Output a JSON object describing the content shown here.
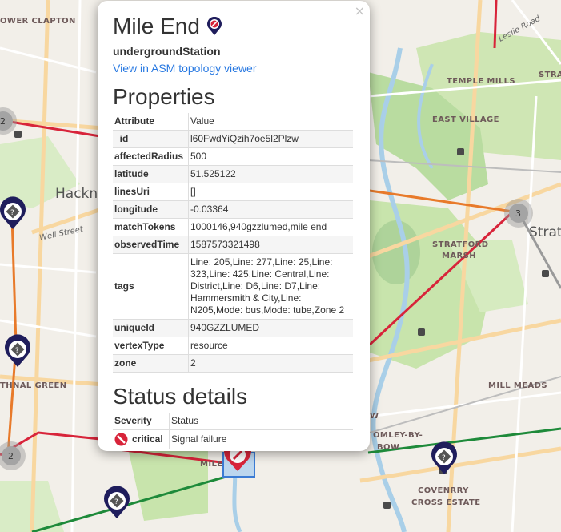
{
  "map": {
    "labels": {
      "lower_clapton": "OWER CLAPTON",
      "temple_mills": "TEMPLE MILLS",
      "east_village": "EAST VILLAGE",
      "strat_top": "STRAT",
      "hackney": "Hackn",
      "well_street": "Well Street",
      "leslie_road": "Leslie Road",
      "stratford": "Strat",
      "stratford_marsh_1": "STRATFORD",
      "stratford_marsh_2": "MARSH",
      "thnal_green": "THNAL GREEN",
      "mill_meads": "MILL MEADS",
      "bromley_1": "OMLEY-BY-",
      "bromley_2": "BOW",
      "coventry_1": "COVENRRY",
      "coventry_2": "CROSS ESTATE",
      "mile_partial": "MILE",
      "w_partial": "W"
    },
    "clusters": {
      "left_top": "2",
      "stratford": "3",
      "left_bottom": "2"
    }
  },
  "popup": {
    "title": "Mile End",
    "type": "undergroundStation",
    "link": "View in ASM topology viewer",
    "close": "×",
    "properties_heading": "Properties",
    "properties_header": {
      "key": "Attribute",
      "value": "Value"
    },
    "properties": [
      {
        "key": "_id",
        "value": "l60FwdYiQzih7oe5l2Plzw"
      },
      {
        "key": "affectedRadius",
        "value": "500"
      },
      {
        "key": "latitude",
        "value": "51.525122"
      },
      {
        "key": "linesUri",
        "value": "[]"
      },
      {
        "key": "longitude",
        "value": "-0.03364"
      },
      {
        "key": "matchTokens",
        "value": "1000146,940gzzlumed,mile end"
      },
      {
        "key": "observedTime",
        "value": "1587573321498"
      },
      {
        "key": "tags",
        "value": "Line: 205,Line: 277,Line: 25,Line: 323,Line: 425,Line: Central,Line: District,Line: D6,Line: D7,Line: Hammersmith & City,Line: N205,Mode: bus,Mode: tube,Zone 2"
      },
      {
        "key": "uniqueId",
        "value": "940GZZLUMED"
      },
      {
        "key": "vertexType",
        "value": "resource"
      },
      {
        "key": "zone",
        "value": "2"
      }
    ],
    "status_heading": "Status details",
    "status_header": {
      "key": "Severity",
      "value": "Status"
    },
    "status": {
      "severity": "critical",
      "status": "Signal failure"
    }
  },
  "colors": {
    "critical": "#d8243a",
    "marker": "#1f1d5c",
    "link": "#2a7ae2"
  }
}
